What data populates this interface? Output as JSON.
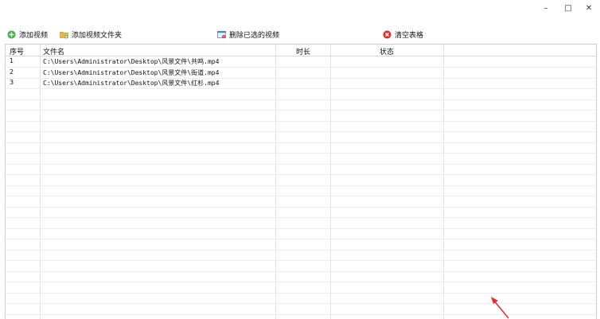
{
  "window": {
    "minimize_glyph": "–",
    "maximize_glyph": "□",
    "close_glyph": "✕"
  },
  "toolbar": {
    "add_video": "添加视频",
    "add_folder": "添加视频文件夹",
    "delete_selected": "删除已选的视频",
    "clear_table": "清空表格"
  },
  "table": {
    "columns": [
      "序号",
      "文件名",
      "时长",
      "状态"
    ],
    "rows": [
      {
        "index": "1",
        "filename": "C:\\Users\\Administrator\\Desktop\\风景文件\\共鸣.mp4",
        "duration": "",
        "status": ""
      },
      {
        "index": "2",
        "filename": "C:\\Users\\Administrator\\Desktop\\风景文件\\街道.mp4",
        "duration": "",
        "status": ""
      },
      {
        "index": "3",
        "filename": "C:\\Users\\Administrator\\Desktop\\风景文件\\红杉.mp4",
        "duration": "",
        "status": ""
      }
    ]
  },
  "colors": {
    "add_icon": "#4caf50",
    "folder_icon": "#e6b84a",
    "delete_icon": "#4a7fd4",
    "clear_icon": "#d9302c",
    "annotation_arrow": "#e03030"
  }
}
